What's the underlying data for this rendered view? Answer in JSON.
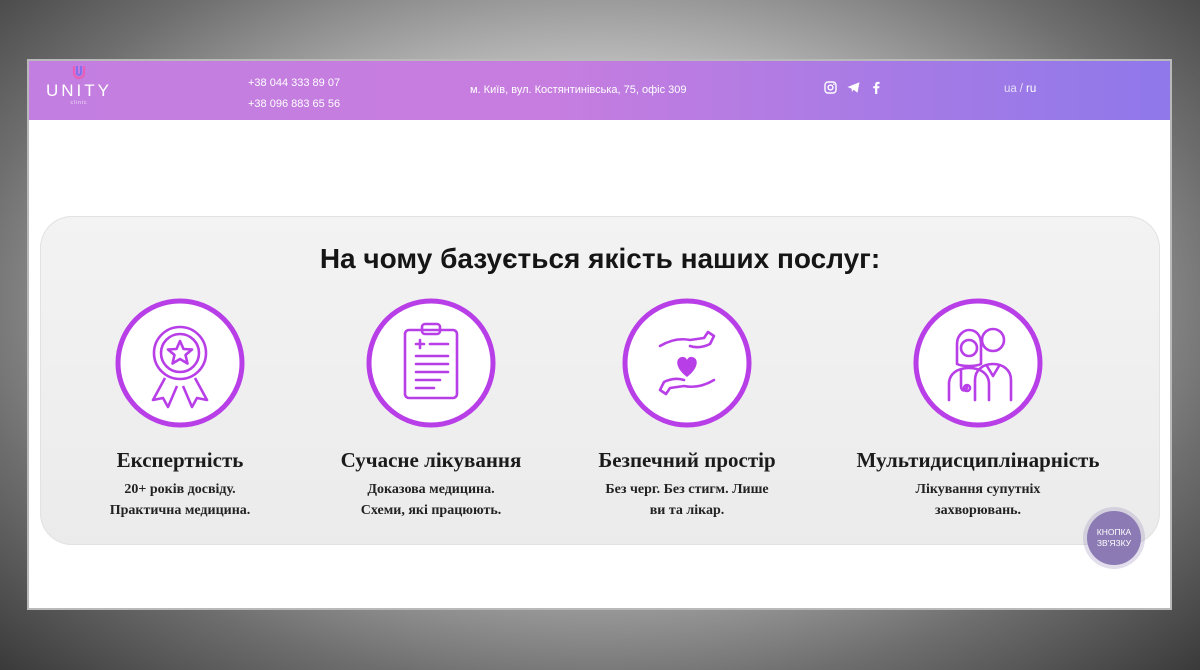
{
  "header": {
    "logo_text": "UNITY",
    "logo_sub": "clinic",
    "phones": [
      "+38 044 333 89 07",
      "+38 096 883 65 56"
    ],
    "address": "м. Київ, вул. Костянтинівська, 75, офіс 309",
    "social": [
      "instagram-icon",
      "telegram-icon",
      "facebook-icon"
    ],
    "lang": {
      "ua": "ua",
      "separator": "/",
      "ru": "ru"
    }
  },
  "section": {
    "heading": "На чому базується якість наших послуг:",
    "features": [
      {
        "icon": "award-badge-icon",
        "title": "Експертність",
        "desc": [
          "20+ років досвіду.",
          "Практична медицина."
        ]
      },
      {
        "icon": "medical-clipboard-icon",
        "title": "Сучасне лікування",
        "desc": [
          "Доказова медицина.",
          "Схеми, які працюють."
        ]
      },
      {
        "icon": "hands-heart-icon",
        "title": "Безпечний простір",
        "desc": [
          "Без черг. Без стигм. Лише",
          "ви та лікар."
        ]
      },
      {
        "icon": "doctors-icon",
        "title": "Мультидисциплінарність",
        "desc": [
          "Лікування супутніх",
          "захворювань."
        ]
      }
    ]
  },
  "contact_button": {
    "line1": "КНОПКА",
    "line2": "ЗВ'ЯЗКУ"
  },
  "colors": {
    "accent": "#b83ee8",
    "header_start": "#c27ee0",
    "header_end": "#8f78ea",
    "contact": "#8b7ab4"
  }
}
